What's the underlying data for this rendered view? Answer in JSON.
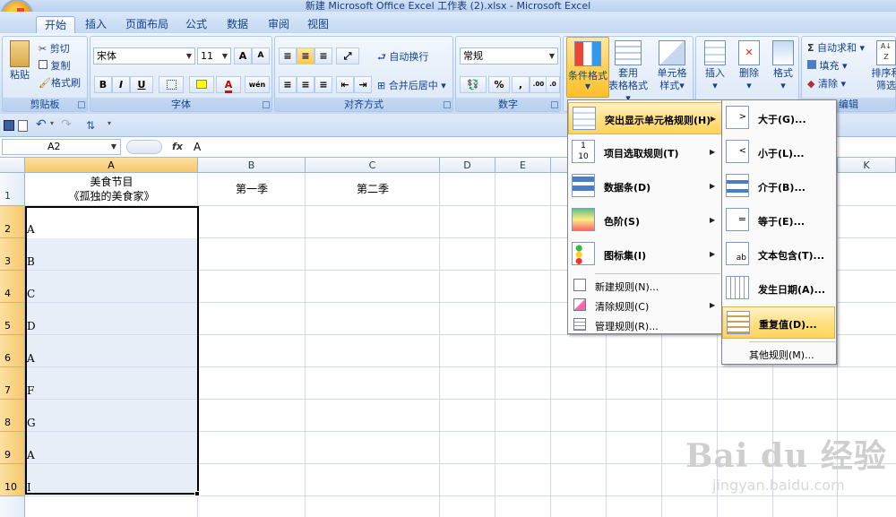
{
  "window": {
    "title": "新建 Microsoft Office Excel 工作表 (2).xlsx - Microsoft Excel"
  },
  "tabs": [
    "开始",
    "插入",
    "页面布局",
    "公式",
    "数据",
    "审阅",
    "视图"
  ],
  "ribbon": {
    "clipboard": {
      "paste": "粘贴",
      "cut": "剪切",
      "copy": "复制",
      "format_painter": "格式刷",
      "label": "剪贴板"
    },
    "font": {
      "name": "宋体",
      "size": "11",
      "bold": "B",
      "italic": "I",
      "underline": "U",
      "grow": "A",
      "shrink": "A",
      "label": "字体"
    },
    "alignment": {
      "wrap": "自动换行",
      "merge": "合并后居中",
      "label": "对齐方式"
    },
    "number": {
      "format": "常规",
      "label": "数字"
    },
    "styles": {
      "conditional": "条件格式",
      "table1": "套用",
      "table2": "表格格式",
      "cell1": "单元格",
      "cell2": "样式"
    },
    "cells": {
      "insert": "插入",
      "delete": "删除",
      "format": "格式"
    },
    "editing": {
      "autosum": "自动求和",
      "fill": "填充",
      "clear": "清除",
      "sort1": "排序和",
      "sort2": "筛选",
      "label": "编辑"
    }
  },
  "formula_bar": {
    "name_box": "A2",
    "fx": "fx",
    "content": "A"
  },
  "columns": [
    "A",
    "B",
    "C",
    "D",
    "E",
    "K"
  ],
  "rows": [
    "1",
    "2",
    "3",
    "4",
    "5",
    "6",
    "7",
    "8",
    "9",
    "10"
  ],
  "cells": {
    "a1_line1": "美食节目",
    "a1_line2": "《孤独的美食家》",
    "b1": "第一季",
    "c1": "第二季",
    "col_a_values": [
      "A",
      "B",
      "C",
      "D",
      "A",
      "F",
      "G",
      "A",
      "I"
    ]
  },
  "cf_menu": {
    "items": [
      {
        "label": "突出显示单元格规则(H)"
      },
      {
        "label": "项目选取规则(T)"
      },
      {
        "label": "数据条(D)"
      },
      {
        "label": "色阶(S)"
      },
      {
        "label": "图标集(I)"
      }
    ],
    "small_items": [
      {
        "label": "新建规则(N)..."
      },
      {
        "label": "清除规则(C)"
      },
      {
        "label": "管理规则(R)..."
      }
    ]
  },
  "highlight_submenu": {
    "items": [
      {
        "label": "大于(G)..."
      },
      {
        "label": "小于(L)..."
      },
      {
        "label": "介于(B)..."
      },
      {
        "label": "等于(E)..."
      },
      {
        "label": "文本包含(T)..."
      },
      {
        "label": "发生日期(A)..."
      },
      {
        "label": "重复值(D)..."
      }
    ],
    "other": "其他规则(M)..."
  },
  "watermark": {
    "logo": "Bai du 经验",
    "url": "jingyan.baidu.com"
  }
}
